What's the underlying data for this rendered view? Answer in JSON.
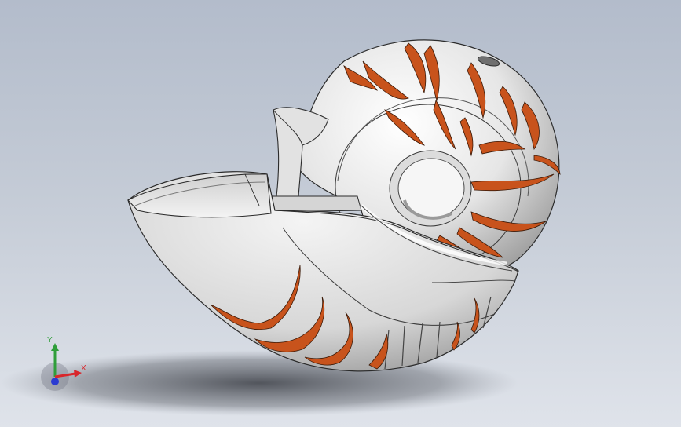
{
  "viewport": {
    "background_top": "#b3bccb",
    "background_bottom": "#dfe3ea"
  },
  "model": {
    "shell_color": "#e7e7e7",
    "stripe_color": "#c8531c",
    "outline_color": "#2b2b2b"
  },
  "triad": {
    "x_label": "X",
    "y_label": "Y",
    "x_color": "#d9262b",
    "y_color": "#2f9e3a",
    "z_color": "#2b3bd1"
  }
}
